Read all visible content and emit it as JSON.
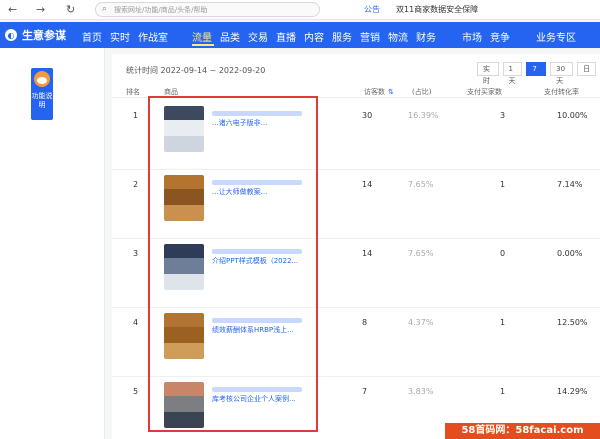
{
  "browser": {
    "back": "←",
    "forward": "→",
    "reload": "↻",
    "search_placeholder": "搜索网址/功能/商品/头条/帮助",
    "announcement_label": "公告",
    "announcement_text": "双11商家数据安全保障"
  },
  "nav": {
    "brand": "生意参谋",
    "items": [
      "首页",
      "实时",
      "作战室",
      "流量",
      "品类",
      "交易",
      "直播",
      "内容",
      "服务",
      "营销",
      "物流",
      "财务",
      "市场",
      "竞争",
      "业务专区"
    ],
    "active": "流量"
  },
  "sidebar": {
    "func_label": "功能说明"
  },
  "panel": {
    "period": "统计时间 2022-09-14 ~ 2022-09-20",
    "tabs": [
      "实时",
      "1天",
      "7天",
      "30天",
      "日"
    ],
    "active_tab": "7天"
  },
  "table": {
    "headers": {
      "rank": "排名",
      "product": "商品",
      "visitors": "访客数",
      "share": "(占比)",
      "buyers": "支付买家数",
      "conversion": "支付转化率"
    },
    "sort_icon": "⇅",
    "rows": [
      {
        "rank": "1",
        "title": "...诸六电子版非...",
        "visitors": "30",
        "share": "16.39%",
        "buyers": "3",
        "conversion": "10.00%",
        "thumb_colors": [
          "#3d4a5e",
          "#e9ecf1",
          "#cfd5de"
        ]
      },
      {
        "rank": "2",
        "title": "...让大师做教案...",
        "visitors": "14",
        "share": "7.65%",
        "buyers": "1",
        "conversion": "7.14%",
        "thumb_colors": [
          "#b2742e",
          "#8a5520",
          "#c99050"
        ]
      },
      {
        "rank": "3",
        "title": "介绍PPT样式模板（2022...",
        "visitors": "14",
        "share": "7.65%",
        "buyers": "0",
        "conversion": "0.00%",
        "thumb_colors": [
          "#2f3c57",
          "#6e7d98",
          "#dfe3ea"
        ]
      },
      {
        "rank": "4",
        "title": "绩效薪酬体系HRBP浅上...",
        "visitors": "8",
        "share": "4.37%",
        "buyers": "1",
        "conversion": "12.50%",
        "thumb_colors": [
          "#b27432",
          "#9a6122",
          "#cf9d5a"
        ]
      },
      {
        "rank": "5",
        "title": "库考核公司企业个人案例...",
        "visitors": "7",
        "share": "3.83%",
        "buyers": "1",
        "conversion": "14.29%",
        "thumb_colors": [
          "#c98568",
          "#7d7e82",
          "#3b4453"
        ]
      }
    ]
  },
  "watermark": "58首码网：58facai.com"
}
